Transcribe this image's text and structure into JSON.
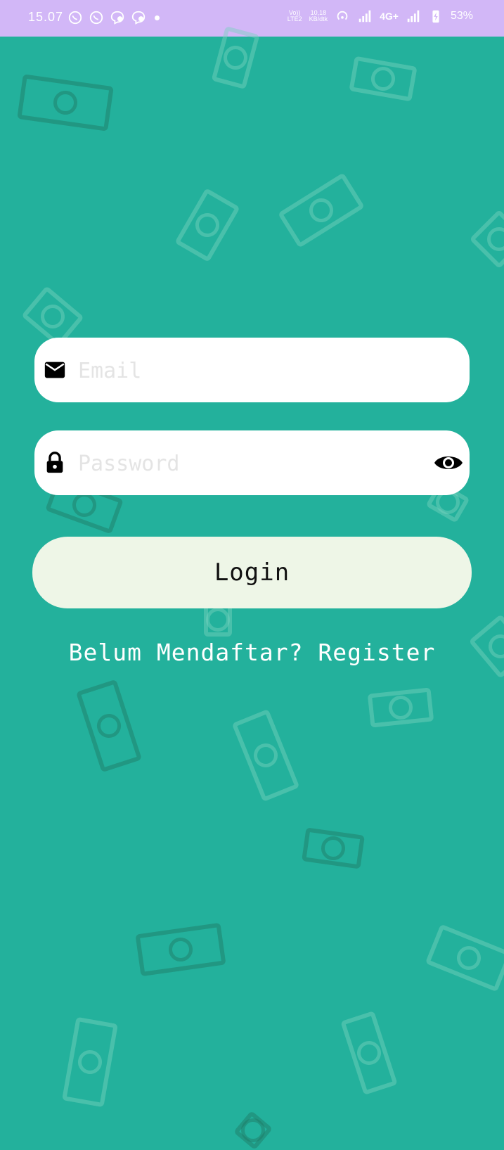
{
  "status_bar": {
    "time": "15.07",
    "volte_top": "Vo))",
    "volte_bottom": "LTE2",
    "speed_value": "10,18",
    "speed_unit": "KB/dtk",
    "network": "4G+",
    "battery": "53%",
    "notification_icons": [
      "whatsapp-icon",
      "whatsapp-icon",
      "facebook-messenger-icon",
      "facebook-messenger-icon",
      "dot-icon"
    ]
  },
  "login": {
    "email_placeholder": "Email",
    "email_value": "",
    "password_placeholder": "Password",
    "password_value": "",
    "login_label": "Login",
    "register_prefix": "Belum Mendaftar?",
    "register_link": "Register"
  },
  "colors": {
    "background": "#23b19c",
    "status_bar": "#d2b7f7",
    "button_bg": "#eef6e7",
    "field_bg": "#ffffff"
  }
}
